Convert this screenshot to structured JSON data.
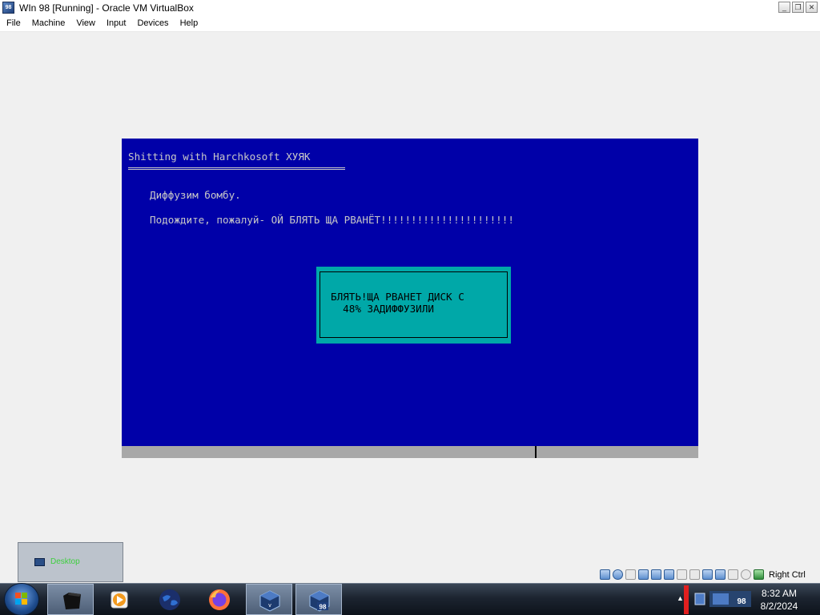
{
  "window": {
    "title": "WIn 98 [Running] - Oracle VM VirtualBox",
    "icon_badge": "98",
    "controls": {
      "minimize": "_",
      "restore": "❐",
      "close": "✕"
    }
  },
  "menu": [
    "File",
    "Machine",
    "View",
    "Input",
    "Devices",
    "Help"
  ],
  "guest": {
    "title": "Shitting with Harchkosoft ХУЯК",
    "line1": "Диффузим бомбу.",
    "line2": "Подождите, пожалуй- ОЙ БЛЯТЬ ЩА РВАНЁТ!!!!!!!!!!!!!!!!!!!!!!",
    "dialog_line1": "БЛЯТЬ!ЩА РВАНЕТ ДИСК С",
    "dialog_line2": "  48% ЗАДИФФУЗИЛИ",
    "colors": {
      "background": "#0000a8",
      "text": "#c8c8c8",
      "dialog": "#00a8a8",
      "statusbar": "#a8a8a8"
    }
  },
  "vbox_status": {
    "icons": [
      "hard-disk-icon",
      "optical-drive-icon",
      "floppy-icon",
      "audio-icon",
      "network-icon",
      "usb-icon",
      "shared-folders-icon",
      "display-icon",
      "video-capture-icon",
      "clipboard-icon",
      "mouse-integration-icon",
      "cpu-icon",
      "keyboard-icon"
    ],
    "host_key": "Right Ctrl"
  },
  "desktop_preview": {
    "label": "Desktop"
  },
  "taskbar": {
    "apps": [
      "terminal-icon",
      "media-player-icon",
      "globe-icon",
      "firefox-icon",
      "virtualbox-icon",
      "win98-vm-icon"
    ],
    "tray_badge": "98",
    "time": "8:32 AM",
    "date": "8/2/2024"
  }
}
